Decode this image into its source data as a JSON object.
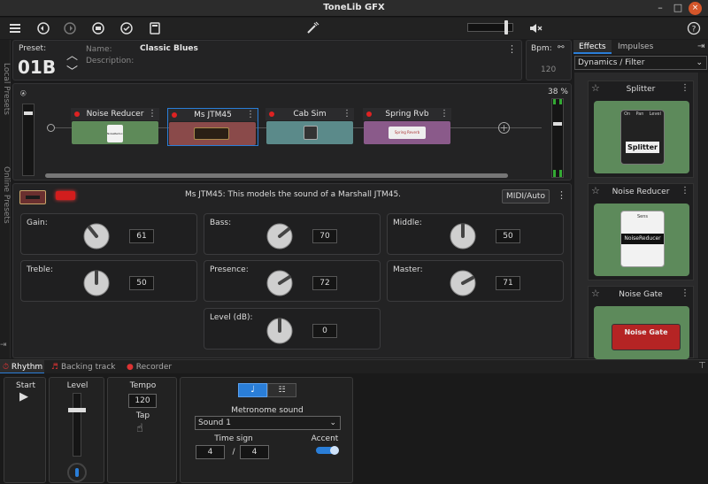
{
  "window": {
    "title": "ToneLib GFX",
    "min": "–",
    "max": "□",
    "close": "×"
  },
  "toolbar": {
    "master_volume": 0.85
  },
  "left_tabs": {
    "local": "Local Presets",
    "online": "Online Presets"
  },
  "preset": {
    "label": "Preset:",
    "number": "01B",
    "name_label": "Name:",
    "name": "Classic Blues",
    "description_label": "Description:",
    "bpm_label": "Bpm:",
    "bpm": "120"
  },
  "chain": {
    "input_level": "38 %",
    "slots": [
      {
        "name": "Noise Reducer",
        "body_color": "#5e8a59",
        "thumb": "NoiseReducer"
      },
      {
        "name": "Ms JTM45",
        "body_color": "#8a4a4a",
        "thumb": ""
      },
      {
        "name": "Cab Sim",
        "body_color": "#5b8a8a",
        "thumb": ""
      },
      {
        "name": "Spring Rvb",
        "body_color": "#8a5a8a",
        "thumb": "Spring Reverb"
      }
    ]
  },
  "amp": {
    "description": "Ms JTM45:  This models the sound of a Marshall JTM45.",
    "midi_button": "MIDI/Auto",
    "controls": [
      {
        "label": "Gain:",
        "value": "61"
      },
      {
        "label": "Bass:",
        "value": "70"
      },
      {
        "label": "Middle:",
        "value": "50"
      },
      {
        "label": "Treble:",
        "value": "50"
      },
      {
        "label": "Presence:",
        "value": "72"
      },
      {
        "label": "Master:",
        "value": "71"
      },
      {
        "label": "Level (dB):",
        "value": "0"
      }
    ]
  },
  "right_panel": {
    "tabs": [
      "Effects",
      "Impulses"
    ],
    "category": "Dynamics / Filter",
    "effects": [
      {
        "name": "Splitter",
        "pedal_label": "Splitter",
        "knob_labels": [
          "On",
          "Pan",
          "Level"
        ]
      },
      {
        "name": "Noise Reducer",
        "pedal_label": "NoiseReducer",
        "knob_labels": [
          "Sens"
        ]
      },
      {
        "name": "Noise Gate",
        "pedal_label": "Noise Gate",
        "knob_labels": []
      }
    ]
  },
  "bottom": {
    "tabs": [
      "Rhythm",
      "Backing track",
      "Recorder"
    ],
    "start_label": "Start",
    "level_label": "Level",
    "tempo_label": "Tempo",
    "tempo": "120",
    "tap_label": "Tap",
    "metronome_label": "Metronome sound",
    "sound": "Sound 1",
    "time_sign_label": "Time sign",
    "time_sign_num": "4",
    "time_sign_sep": "/",
    "time_sign_den": "4",
    "accent_label": "Accent"
  },
  "colors": {
    "accent": "#2a7ed8",
    "led": "#dd2222",
    "selected_border": "#2a7ed8"
  }
}
